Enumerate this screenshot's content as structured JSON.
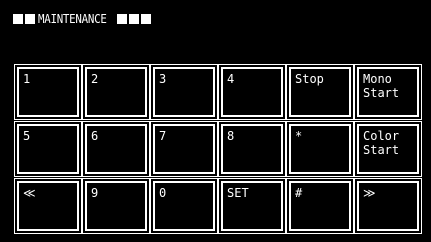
{
  "header": {
    "title": "MAINTENANCE",
    "left_squares": 2,
    "right_squares": 3
  },
  "keypad": {
    "rows": [
      [
        {
          "name": "key-1",
          "label": "1"
        },
        {
          "name": "key-2",
          "label": "2"
        },
        {
          "name": "key-3",
          "label": "3"
        },
        {
          "name": "key-4",
          "label": "4"
        },
        {
          "name": "stop-button",
          "label": "Stop"
        },
        {
          "name": "mono-start-button",
          "label": "Mono\nStart"
        }
      ],
      [
        {
          "name": "key-5",
          "label": "5"
        },
        {
          "name": "key-6",
          "label": "6"
        },
        {
          "name": "key-7",
          "label": "7"
        },
        {
          "name": "key-8",
          "label": "8"
        },
        {
          "name": "asterisk-key",
          "label": "*"
        },
        {
          "name": "color-start-button",
          "label": "Color\nStart"
        }
      ],
      [
        {
          "name": "previous-button",
          "label": "≪"
        },
        {
          "name": "key-9",
          "label": "9"
        },
        {
          "name": "key-0",
          "label": "0"
        },
        {
          "name": "set-button",
          "label": "SET"
        },
        {
          "name": "hash-key",
          "label": "#"
        },
        {
          "name": "next-button",
          "label": "≫"
        }
      ]
    ]
  }
}
